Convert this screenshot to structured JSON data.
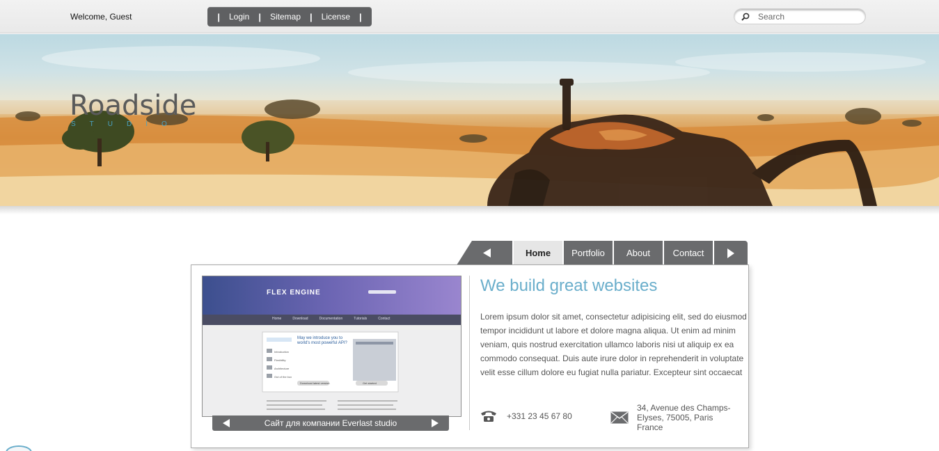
{
  "topbar": {
    "welcome": "Welcome, Guest",
    "links": [
      "Login",
      "Sitemap",
      "License"
    ],
    "separator": "|",
    "search_placeholder": "Search"
  },
  "logo": {
    "name": "Roadside",
    "sub": "STUDIO"
  },
  "tabs": {
    "prev_icon": "triangle-left-icon",
    "items": [
      "Home",
      "Portfolio",
      "About",
      "Contact"
    ],
    "active": "Home",
    "next_icon": "triangle-right-icon"
  },
  "showcase": {
    "caption": "Сайт для компании Everlast studio",
    "preview": {
      "brand": "FLEX ENGINE",
      "nav": [
        "Home",
        "Download",
        "Documentation",
        "Tutorials",
        "Contact"
      ],
      "intro_title": "May we introduce you to world's most powerful API?",
      "sidebar_items": [
        "Introduction",
        "Flexibility",
        "Architecture",
        "Out of the box",
        "Configuration",
        "Security",
        "Clear code"
      ],
      "button_one": "Download latest version",
      "button_two": "Get started"
    }
  },
  "content": {
    "headline": "We build great websites",
    "body": "Lorem ipsum dolor sit amet, consectetur adipisicing elit, sed do eiusmod tempor incididunt ut labore et dolore magna aliqua. Ut enim ad minim veniam, quis nostrud exercitation ullamco laboris nisi ut aliquip ex ea commodo consequat. Duis aute irure dolor in reprehenderit in voluptate velit esse cillum dolore eu fugiat nulla pariatur. Excepteur sint occaecat",
    "phone": "+331 23 45 67 80",
    "address": "34, Avenue des Champs-Elyses, 75005, Paris France"
  },
  "colors": {
    "accent": "#6aaecb",
    "nav_dark": "#6a6b6d",
    "text": "#555555"
  }
}
